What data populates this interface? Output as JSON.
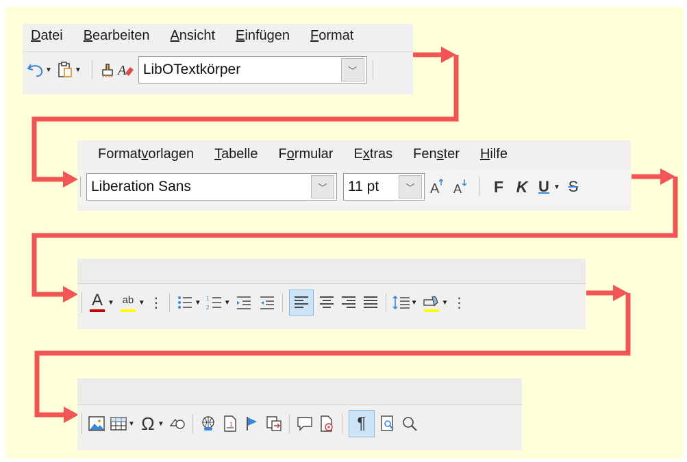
{
  "menus": {
    "row1": [
      "Datei",
      "Bearbeiten",
      "Ansicht",
      "Einfügen",
      "Format"
    ],
    "row2": [
      "Formatvorlagen",
      "Tabelle",
      "Formular",
      "Extras",
      "Fenster",
      "Hilfe"
    ]
  },
  "toolbar1": {
    "paragraph_style": "LibOTextkörper"
  },
  "toolbar2": {
    "font_name": "Liberation Sans",
    "font_size": "11 pt",
    "bold_label": "F",
    "italic_label": "K",
    "underline_label": "U",
    "strike_label": "S"
  },
  "toolbar3": {
    "font_color_letter": "A",
    "highlight_letters": "ab"
  },
  "colors": {
    "arrow": "#f25555",
    "font_color": "#c00000",
    "highlight": "#ffff00",
    "background": "#ffffd9"
  }
}
